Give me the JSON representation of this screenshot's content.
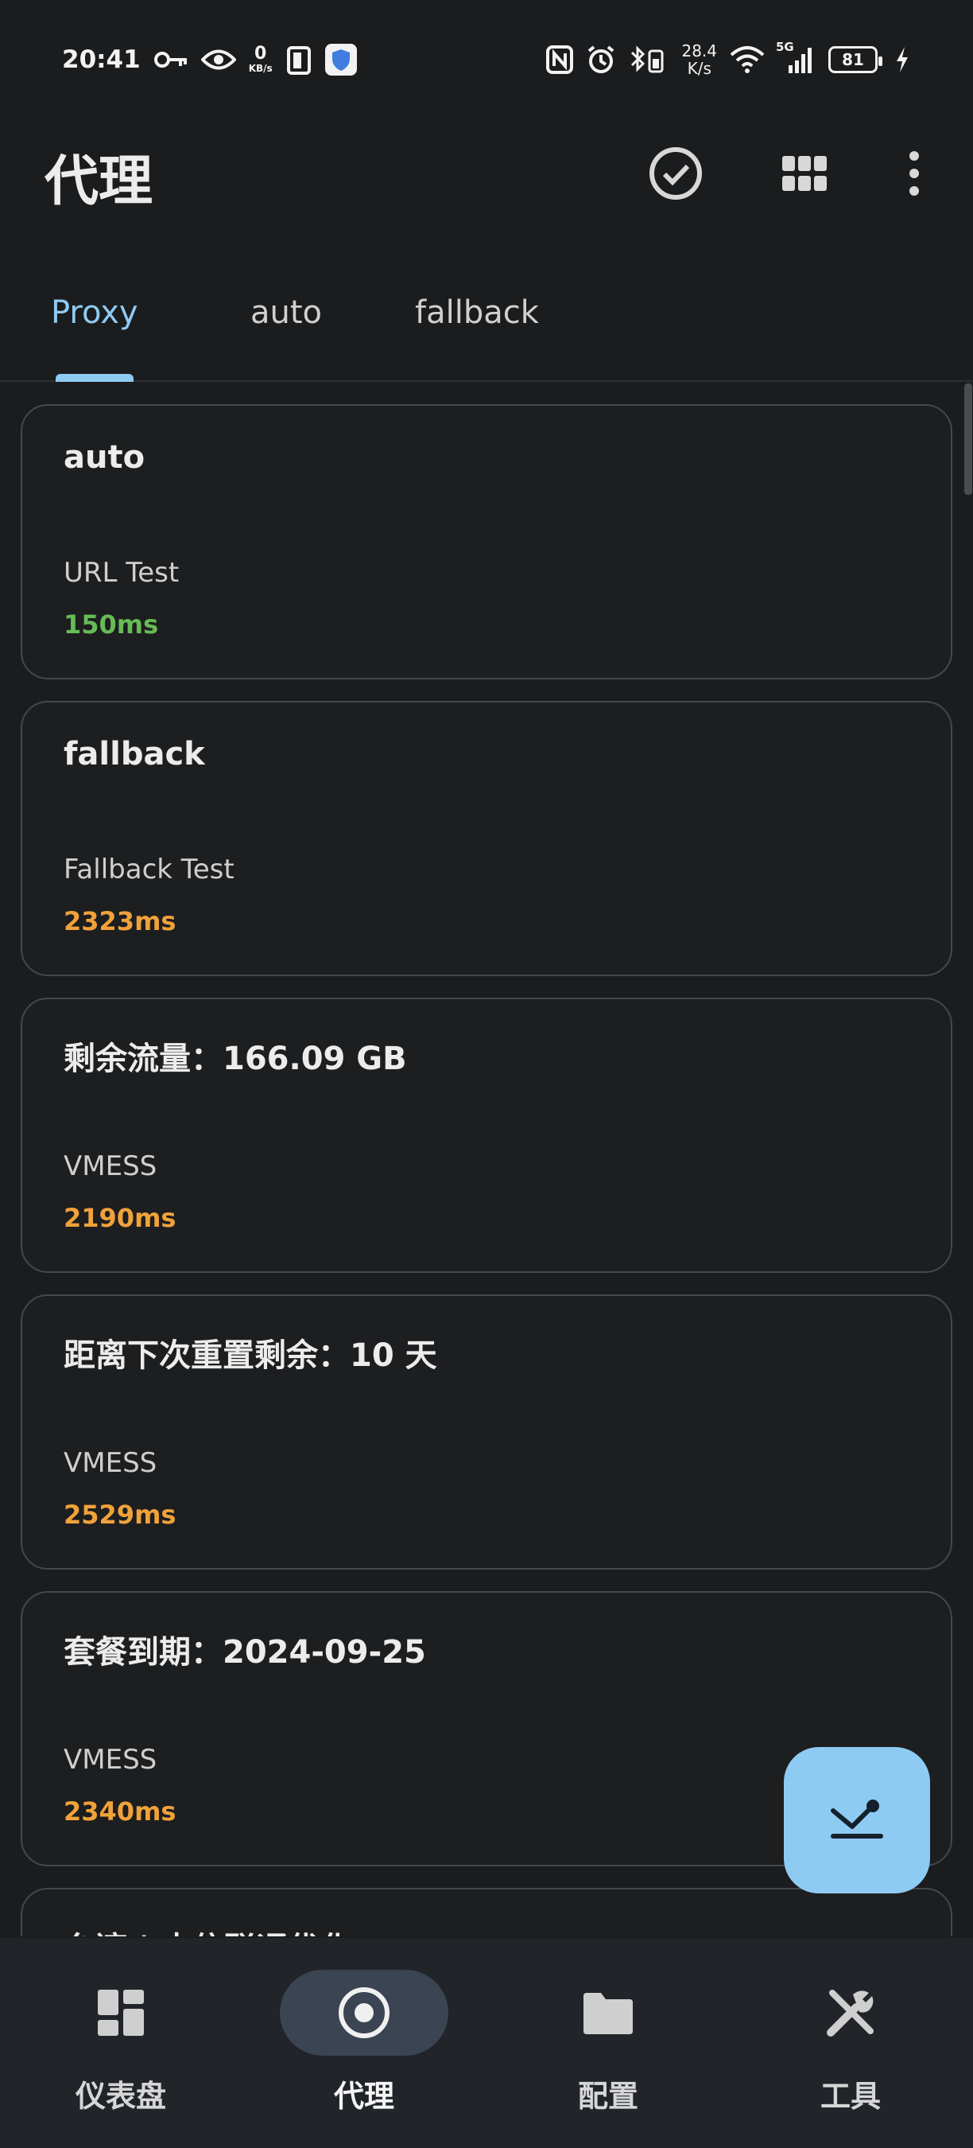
{
  "status_bar": {
    "time": "20:41",
    "net_speed_left_value": "0",
    "net_speed_left_unit": "KB/s",
    "net_speed_right_value": "28.4",
    "net_speed_right_unit": "K/s",
    "network_label": "5G",
    "battery": "81",
    "icons": [
      "key-icon",
      "eye-icon",
      "phone-icon",
      "shield-icon",
      "nfc-icon",
      "alarm-icon",
      "bluetooth-battery-icon",
      "wifi-icon",
      "signal-icon",
      "battery-icon",
      "charging-icon"
    ]
  },
  "app_bar": {
    "title": "代理",
    "actions": [
      "check-circle-icon",
      "grid-icon",
      "more-vert-icon"
    ]
  },
  "tabs": [
    {
      "label": "Proxy",
      "active": true
    },
    {
      "label": "auto",
      "active": false
    },
    {
      "label": "fallback",
      "active": false
    }
  ],
  "proxies": [
    {
      "title": "auto",
      "type": "URL Test",
      "delay": "150ms"
    },
    {
      "title": "fallback",
      "type": "Fallback Test",
      "delay": "2323ms"
    },
    {
      "title": "剩余流量：166.09 GB",
      "type": "VMESS",
      "delay": "2190ms"
    },
    {
      "title": "距离下次重置剩余：10 天",
      "type": "VMESS",
      "delay": "2529ms"
    },
    {
      "title": "套餐到期：2024-09-25",
      "type": "VMESS",
      "delay": "2340ms"
    },
    {
      "title": "台湾 | 电信联通优化",
      "type": "",
      "delay": ""
    }
  ],
  "colors": {
    "accent": "#8ecbf3",
    "delay_good": "#66bb55",
    "delay_slow": "#f0a23a",
    "background": "#1b1c1e",
    "nav_background": "#212429"
  },
  "fab": {
    "icon": "scroll-to-location-icon"
  },
  "bottom_nav": [
    {
      "label": "仪表盘",
      "icon": "dashboard-icon",
      "active": false
    },
    {
      "label": "代理",
      "icon": "radio-target-icon",
      "active": true
    },
    {
      "label": "配置",
      "icon": "folder-icon",
      "active": false
    },
    {
      "label": "工具",
      "icon": "tools-icon",
      "active": false
    }
  ]
}
